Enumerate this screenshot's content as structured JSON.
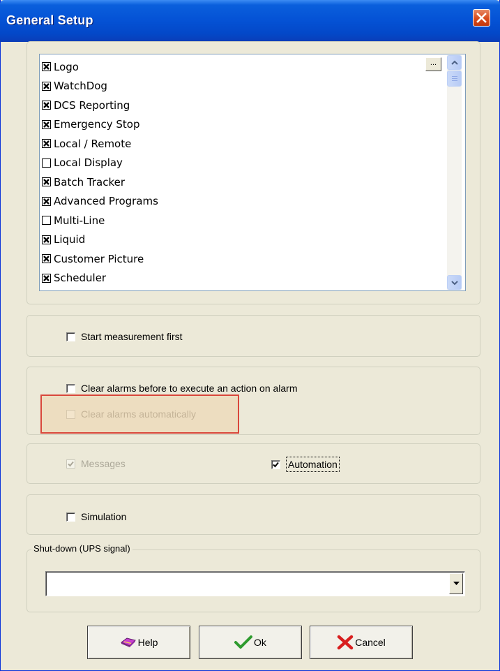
{
  "window": {
    "title": "General Setup"
  },
  "list": {
    "items": [
      {
        "label": "Logo",
        "checked": true
      },
      {
        "label": "WatchDog",
        "checked": true
      },
      {
        "label": "DCS Reporting",
        "checked": true
      },
      {
        "label": "Emergency Stop",
        "checked": true
      },
      {
        "label": "Local / Remote",
        "checked": true
      },
      {
        "label": "Local Display",
        "checked": false
      },
      {
        "label": "Batch Tracker",
        "checked": true
      },
      {
        "label": "Advanced Programs",
        "checked": true
      },
      {
        "label": "Multi-Line",
        "checked": false
      },
      {
        "label": "Liquid",
        "checked": true
      },
      {
        "label": "Customer Picture",
        "checked": true
      },
      {
        "label": "Scheduler",
        "checked": true
      }
    ],
    "ellipsis_label": "..."
  },
  "options": {
    "start_measurement_first": {
      "label": "Start measurement first",
      "checked": false
    },
    "clear_alarms_before_action": {
      "label": "Clear alarms before to execute an action on alarm",
      "checked": false
    },
    "clear_alarms_automatically": {
      "label": "Clear alarms automatically",
      "checked": false,
      "enabled": false
    },
    "messages": {
      "label": "Messages",
      "checked": true,
      "enabled": false
    },
    "automation": {
      "label": "Automation",
      "checked": true
    },
    "simulation": {
      "label": "Simulation",
      "checked": false
    }
  },
  "shutdown": {
    "legend": "Shut-down (UPS signal)",
    "value": ""
  },
  "buttons": {
    "help": "Help",
    "ok": "Ok",
    "cancel": "Cancel"
  },
  "colors": {
    "title_bar": "#0553d6",
    "dialog_bg": "#ece9d8",
    "highlight_border": "#d9473b",
    "ok_check": "#2e9b2e",
    "cancel_x": "#d81e1e"
  }
}
